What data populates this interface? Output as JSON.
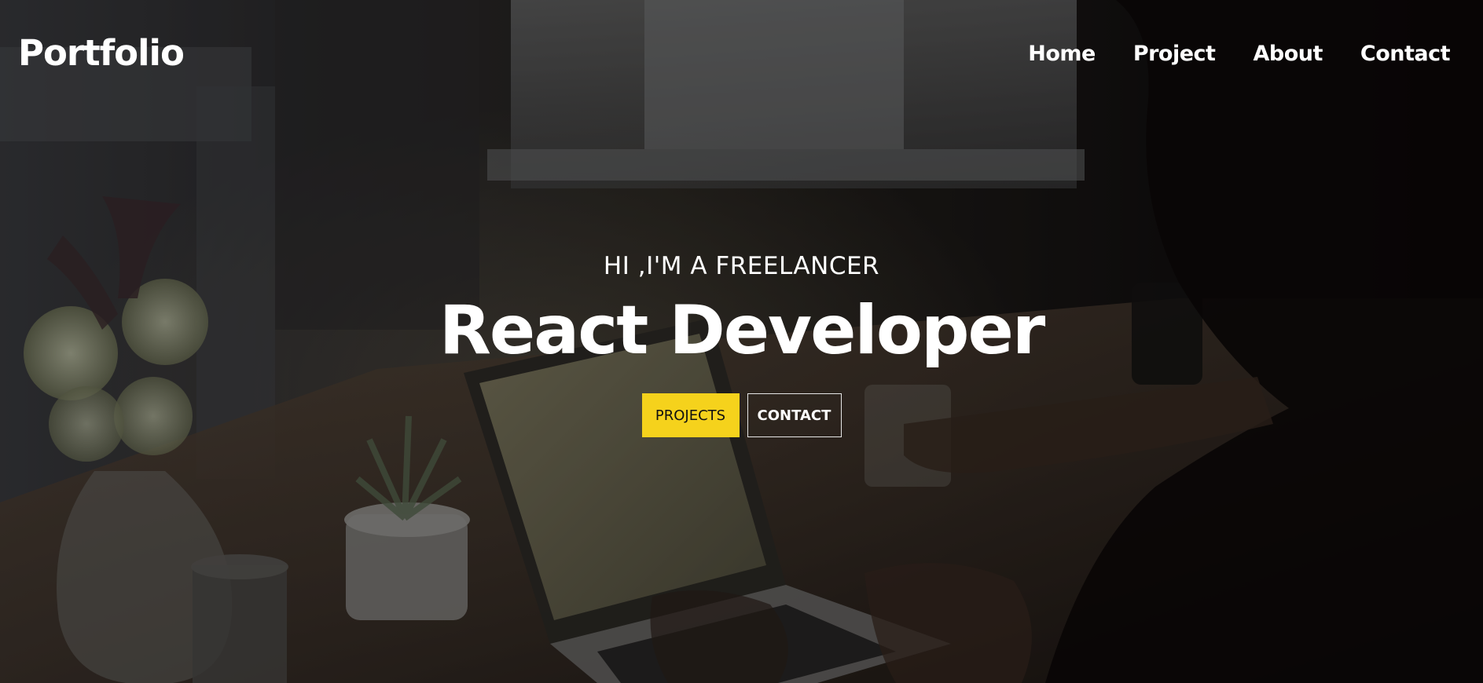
{
  "navbar": {
    "logo": "Portfolio",
    "links": [
      "Home",
      "Project",
      "About",
      "Contact"
    ]
  },
  "hero": {
    "subtitle": "HI ,I'M A FREELANCER",
    "title": "React Developer",
    "primary_button": "PROJECTS",
    "secondary_button": "CONTACT"
  },
  "colors": {
    "accent": "#f5d21c",
    "text": "#ffffff",
    "overlay": "#000000"
  },
  "background_image": "workspace-photo-person-typing-on-laptop"
}
